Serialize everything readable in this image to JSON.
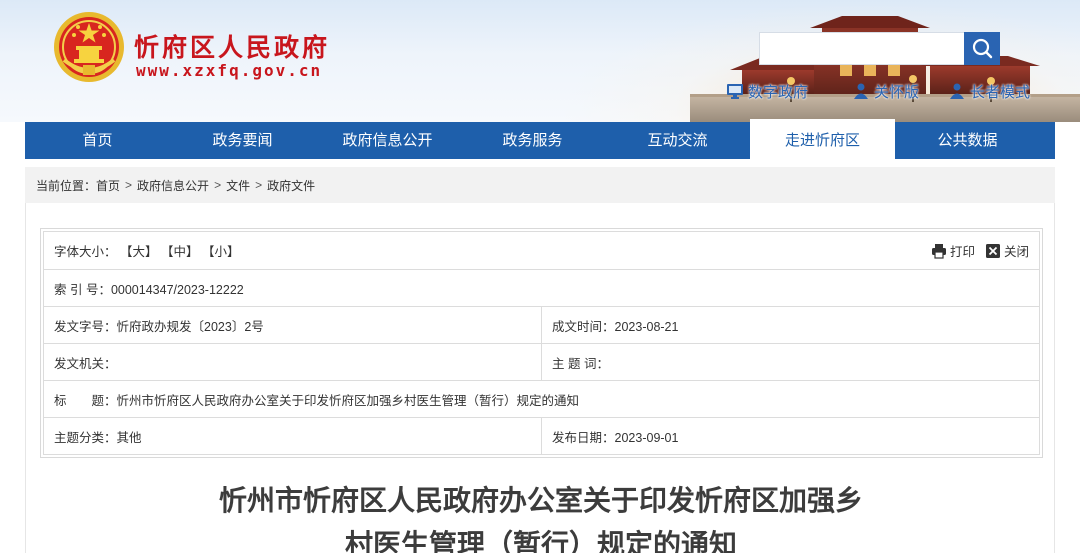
{
  "site": {
    "title": "忻府区人民政府",
    "url": "www.xzxfq.gov.cn"
  },
  "search": {
    "placeholder": "",
    "value": ""
  },
  "tools": [
    {
      "label": "数字政府",
      "icon": "monitor-icon"
    },
    {
      "label": "关怀版",
      "icon": "person-icon"
    },
    {
      "label": "长者模式",
      "icon": "person-icon"
    }
  ],
  "nav": {
    "items": [
      {
        "label": "首页"
      },
      {
        "label": "政务要闻"
      },
      {
        "label": "政府信息公开"
      },
      {
        "label": "政务服务"
      },
      {
        "label": "互动交流"
      },
      {
        "label": "走进忻府区",
        "active": true
      },
      {
        "label": "公共数据"
      }
    ]
  },
  "breadcrumb": {
    "prefix": "当前位置：",
    "items": [
      "首页",
      "政府信息公开",
      "文件",
      "政府文件"
    ],
    "separator": ">"
  },
  "font_size": {
    "label": "字体大小：",
    "large": "【大】",
    "medium": "【中】",
    "small": "【小】"
  },
  "ops": {
    "print": "打印",
    "close": "关闭"
  },
  "meta": {
    "index_label": "索 引 号：",
    "index_value": "000014347/2023-12222",
    "doc_no_label": "发文字号：",
    "doc_no_value": "忻府政办规发〔2023〕2号",
    "created_label": "成文时间：",
    "created_value": "2023-08-21",
    "issuer_label": "发文机关：",
    "issuer_value": "",
    "keywords_label": "主 题 词：",
    "keywords_value": "",
    "title_label": "标　　题：",
    "title_value": "忻州市忻府区人民政府办公室关于印发忻府区加强乡村医生管理（暂行）规定的通知",
    "category_label": "主题分类：",
    "category_value": "其他",
    "published_label": "发布日期：",
    "published_value": "2023-09-01"
  },
  "document": {
    "title_line1": "忻州市忻府区人民政府办公室关于印发忻府区加强乡",
    "title_line2": "村医生管理（暂行）规定的通知"
  },
  "colors": {
    "brand_red": "#c8161d",
    "nav_blue": "#1e5fab",
    "accent_blue": "#2a64b2"
  }
}
